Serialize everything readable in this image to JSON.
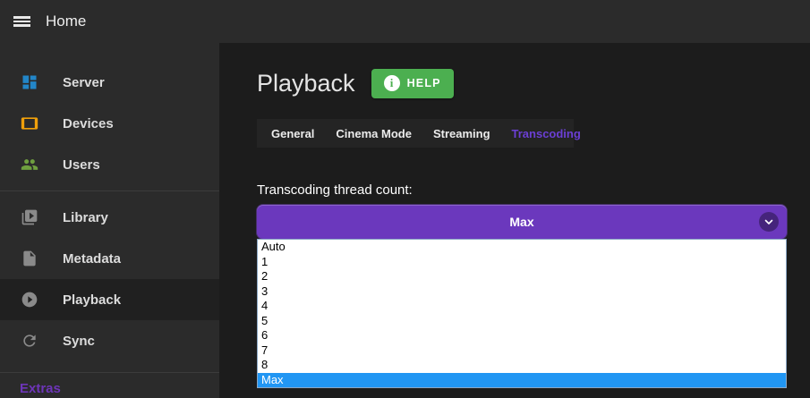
{
  "topbar": {
    "title": "Home"
  },
  "sidebar": {
    "groups": [
      {
        "items": [
          {
            "label": "Server",
            "icon": "dashboard-icon",
            "color": "#2286c8",
            "selected": false
          },
          {
            "label": "Devices",
            "icon": "tablet-icon",
            "color": "#efa00b",
            "selected": false
          },
          {
            "label": "Users",
            "icon": "users-icon",
            "color": "#6f9f3f",
            "selected": false
          }
        ]
      },
      {
        "items": [
          {
            "label": "Library",
            "icon": "video-library-icon",
            "color": "#8a8a8a",
            "selected": false
          },
          {
            "label": "Metadata",
            "icon": "file-icon",
            "color": "#8a8a8a",
            "selected": false
          },
          {
            "label": "Playback",
            "icon": "play-circle-icon",
            "color": "#8a8a8a",
            "selected": true
          },
          {
            "label": "Sync",
            "icon": "sync-icon",
            "color": "#8a8a8a",
            "selected": false
          }
        ]
      }
    ],
    "extras_label": "Extras"
  },
  "main": {
    "title": "Playback",
    "help_button": {
      "label": "HELP",
      "icon": "info-icon"
    },
    "tabs": [
      {
        "label": "General",
        "active": false
      },
      {
        "label": "Cinema Mode",
        "active": false
      },
      {
        "label": "Streaming",
        "active": false
      },
      {
        "label": "Transcoding",
        "active": true
      }
    ],
    "field_label": "Transcoding thread count:",
    "select": {
      "value": "Max",
      "options": [
        "Auto",
        "1",
        "2",
        "3",
        "4",
        "5",
        "6",
        "7",
        "8",
        "Max"
      ],
      "highlighted_option": "Max"
    }
  },
  "colors": {
    "topbar_bg": "#2b2b2b",
    "sidebar_bg": "#2b2b2b",
    "main_bg": "#1c1c1c",
    "accent_purple": "#6b3fd4",
    "select_purple": "#6b38bd",
    "help_green": "#4caf50",
    "option_highlight_blue": "#2196f3"
  }
}
